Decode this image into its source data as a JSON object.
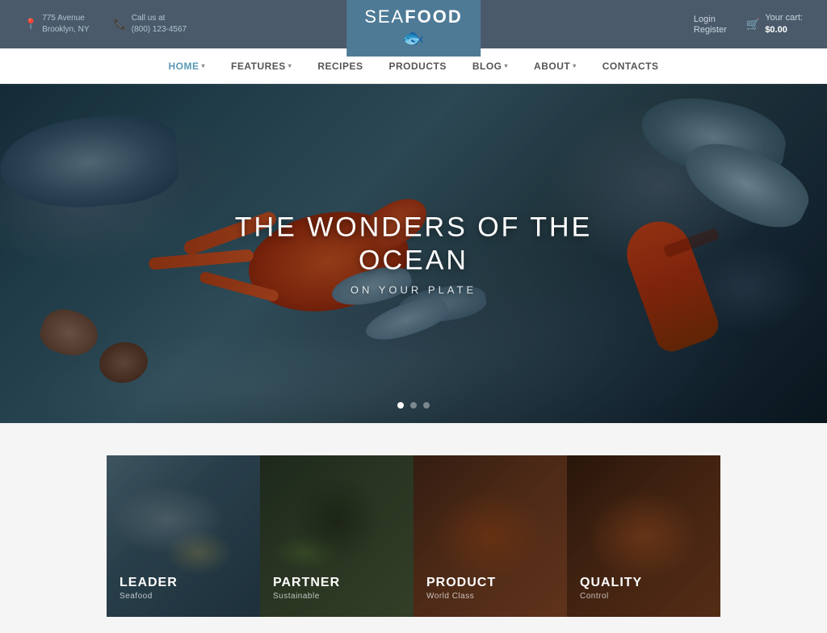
{
  "site": {
    "name_part1": "SEA",
    "name_part2": "FOOD"
  },
  "topbar": {
    "address_label": "775 Avenue\nBrooklyn, NY",
    "phone_label": "Call us at\n(800) 123-4567",
    "login_label": "Login",
    "register_label": "Register",
    "cart_label": "Your cart:",
    "cart_amount": "$0.00"
  },
  "nav": {
    "items": [
      {
        "label": "HOME",
        "active": true,
        "has_dropdown": true
      },
      {
        "label": "FEATURES",
        "active": false,
        "has_dropdown": true
      },
      {
        "label": "RECIPES",
        "active": false,
        "has_dropdown": false
      },
      {
        "label": "PRODUCTS",
        "active": false,
        "has_dropdown": false
      },
      {
        "label": "BLOG",
        "active": false,
        "has_dropdown": true
      },
      {
        "label": "ABOUT",
        "active": false,
        "has_dropdown": true
      },
      {
        "label": "CONTACTS",
        "active": false,
        "has_dropdown": false
      }
    ]
  },
  "hero": {
    "title": "THE WONDERS OF THE OCEAN",
    "subtitle": "ON YOUR PLATE",
    "dots": [
      {
        "active": true
      },
      {
        "active": false
      },
      {
        "active": false
      }
    ]
  },
  "features": {
    "cards": [
      {
        "id": "leader",
        "title": "LEADER",
        "subtitle": "Seafood"
      },
      {
        "id": "partner",
        "title": "PARTNER",
        "subtitle": "Sustainable"
      },
      {
        "id": "product",
        "title": "PRODUCT",
        "subtitle": "World Class"
      },
      {
        "id": "quality",
        "title": "QUALITY",
        "subtitle": "Control"
      }
    ]
  }
}
